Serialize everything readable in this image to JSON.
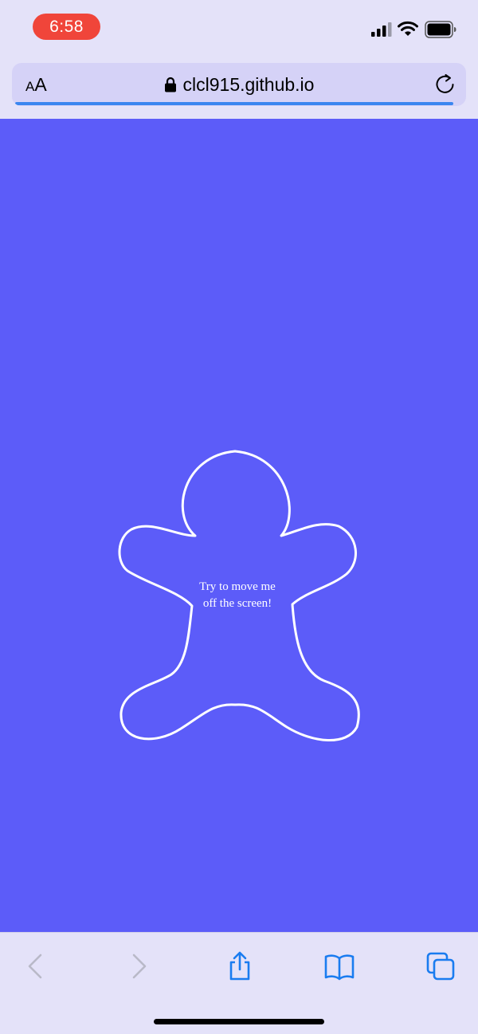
{
  "status_bar": {
    "time": "6:58"
  },
  "address_bar": {
    "text_size_small": "A",
    "text_size_large": "A",
    "url": "clcl915.github.io",
    "load_progress": 1.0
  },
  "page": {
    "background_color": "#5c5cf9",
    "caption_line1": "Try to move me",
    "caption_line2": "off the screen!"
  },
  "toolbar": {
    "icons": [
      "back-icon",
      "forward-icon",
      "share-icon",
      "bookmarks-icon",
      "tabs-icon"
    ],
    "accent_color": "#1a7cf0",
    "disabled_color": "#b9b9c8"
  }
}
